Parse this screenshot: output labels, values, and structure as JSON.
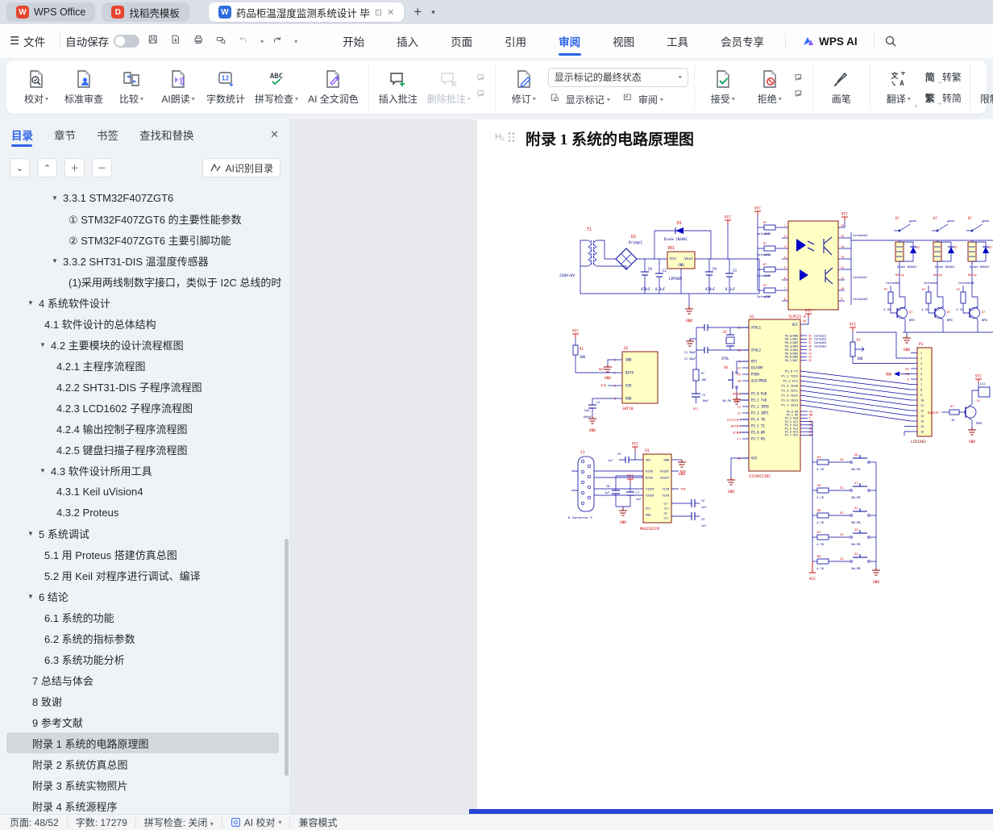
{
  "titlebar": {
    "tabs": [
      {
        "title": "WPS Office"
      },
      {
        "title": "找稻壳模板"
      },
      {
        "title": "药品柜温湿度监测系统设计 毕"
      }
    ],
    "new_tab": "+"
  },
  "menubar": {
    "file": "文件",
    "autosave": "自动保存",
    "items": [
      "开始",
      "插入",
      "页面",
      "引用",
      "审阅",
      "视图",
      "工具",
      "会员专享"
    ],
    "active": "审阅",
    "wps_ai": "WPS AI"
  },
  "ribbon": {
    "proofread": "校对",
    "standard_review": "标准审查",
    "compare": "比较",
    "ai_read": "AI朗读",
    "word_count": "字数统计",
    "spell_check": "拼写检查",
    "ai_polish": "AI 全文润色",
    "insert_comment": "插入批注",
    "delete_comment": "删除批注",
    "track_changes": "修订",
    "markup_state": "显示标记的最终状态",
    "show_markup": "显示标记",
    "reviewer": "审阅",
    "accept": "接受",
    "reject": "拒绝",
    "pen": "画笔",
    "translate": "翻译",
    "s2t_prefix": "简",
    "s2t": "转繁",
    "t2s_prefix": "繁",
    "t2s": "转简",
    "restrict": "限制编辑"
  },
  "sidebar": {
    "tabs": [
      "目录",
      "章节",
      "书签",
      "查找和替换"
    ],
    "active_tab": "目录",
    "ai_button": "AI识别目录",
    "toc": [
      {
        "l": 2,
        "a": 1,
        "t": "3.3.1 STM32F407ZGT6"
      },
      {
        "l": 3,
        "a": 0,
        "t": "① STM32F407ZGT6 的主要性能参数"
      },
      {
        "l": 3,
        "a": 0,
        "t": "② STM32F407ZGT6 主要引脚功能"
      },
      {
        "l": 2,
        "a": 1,
        "t": "3.3.2 SHT31-DIS 温湿度传感器"
      },
      {
        "l": 3,
        "a": 0,
        "t": "(1)采用两线制数字接口，类似于 I2C 总线的时 ..."
      },
      {
        "l": 0,
        "a": 1,
        "t": "4 系统软件设计"
      },
      {
        "l": 1,
        "a": 0,
        "t": "4.1 软件设计的总体结构"
      },
      {
        "l": 1,
        "a": 1,
        "t": "4.2 主要模块的设计流程框图"
      },
      {
        "l": 2,
        "a": 0,
        "t": "4.2.1 主程序流程图"
      },
      {
        "l": 2,
        "a": 0,
        "t": "4.2.2 SHT31-DIS 子程序流程图"
      },
      {
        "l": 2,
        "a": 0,
        "t": "4.2.3 LCD1602 子程序流程图"
      },
      {
        "l": 2,
        "a": 0,
        "t": "4.2.4 输出控制子程序流程图"
      },
      {
        "l": 2,
        "a": 0,
        "t": "4.2.5 键盘扫描子程序流程图"
      },
      {
        "l": 1,
        "a": 1,
        "t": "4.3 软件设计所用工具"
      },
      {
        "l": 2,
        "a": 0,
        "t": "4.3.1 Keil uVision4"
      },
      {
        "l": 2,
        "a": 0,
        "t": "4.3.2 Proteus"
      },
      {
        "l": 0,
        "a": 1,
        "t": "5 系统调试"
      },
      {
        "l": 1,
        "a": 0,
        "t": "5.1 用 Proteus 搭建仿真总图"
      },
      {
        "l": 1,
        "a": 0,
        "t": "5.2 用 Keil 对程序进行调试、编译"
      },
      {
        "l": 0,
        "a": 1,
        "t": "6 结论"
      },
      {
        "l": 1,
        "a": 0,
        "t": "6.1 系统的功能"
      },
      {
        "l": 1,
        "a": 0,
        "t": "6.2 系统的指标参数"
      },
      {
        "l": 1,
        "a": 0,
        "t": "6.3 系统功能分析"
      },
      {
        "l": 0,
        "a": 0,
        "t": "7 总结与体会"
      },
      {
        "l": 0,
        "a": 0,
        "t": "8 致谢"
      },
      {
        "l": 0,
        "a": 0,
        "t": "9 参考文献"
      },
      {
        "l": 0,
        "a": 0,
        "t": "附录 1 系统的电路原理图",
        "sel": 1
      },
      {
        "l": 0,
        "a": 0,
        "t": "附录 2 系统仿真总图"
      },
      {
        "l": 0,
        "a": 0,
        "t": "附录 3 系统实物照片"
      },
      {
        "l": 0,
        "a": 0,
        "t": "附录 4 系统源程序"
      }
    ]
  },
  "document": {
    "heading": "附录 1 系统的电路原理图",
    "h1_tag": "H₁"
  },
  "statusbar": {
    "page_label": "页面: 48/52",
    "words": "字数: 17279",
    "spell": "拼写检查: 关闭",
    "ai": "AI 校对",
    "mode": "兼容模式"
  },
  "schematic": {
    "power": {
      "t1": "T1",
      "ac": "220V~6V",
      "bridge_ref": "D2",
      "bridge_val": "Bridge1",
      "d1": "D1",
      "d1_val": "Diode 1N4001",
      "vr": "VR1",
      "vr_val": "LM7805",
      "vin": "Vin",
      "vout": "Vout",
      "gnd_pin": "GND",
      "vcc": "VCC",
      "caps": [
        [
          "C8",
          "470uF"
        ],
        [
          "C2",
          "0.3uF"
        ],
        [
          "C9",
          "470uF"
        ],
        [
          "C3",
          "0.1uF"
        ]
      ]
    },
    "opto": {
      "ref": "TLP521-4",
      "res_ref": "R?",
      "res_val": "470",
      "left_pins": [
        "Anode",
        "Cathod",
        "Anode",
        "Cathod",
        "Anode",
        "Cathod",
        "Anode",
        "Cathod"
      ],
      "right_pins": [
        "Collector",
        "Emitter",
        "Collector",
        "Emitter",
        "Collector",
        "Emitter",
        "Collector",
        "Emitter"
      ],
      "left_nets": [
        "Cathode2",
        "Cathode4",
        "Cathode6",
        "Cathode8"
      ],
      "right_nets": [
        "Cathode5",
        "Cathode7",
        "Cathode9"
      ]
    },
    "relays": {
      "coil": "Relay",
      "diode_ref": "D?",
      "diode_val": "Diode 1N4001",
      "k": "K?",
      "q": "Q?",
      "qt": "NPN",
      "r": "R?",
      "rv": "4.7K",
      "nets": [
        "Cathode6",
        "Cathode8",
        "Cathode10"
      ]
    },
    "mcu": {
      "ref": "U1",
      "part": "STC89C51RC",
      "vcc": "VCC",
      "left_pins": [
        [
          "19",
          "XTAL1"
        ],
        [
          "18",
          "XTAL2"
        ],
        [
          "9",
          "RST"
        ],
        [
          "31",
          "EA/VPP"
        ],
        [
          "29",
          "PSEN"
        ],
        [
          "30",
          "ALE/PROG"
        ],
        [
          "10",
          "P3.0 RxD"
        ],
        [
          "11",
          "P3.1 TxD"
        ],
        [
          "12",
          "P3.2 INT0"
        ],
        [
          "13",
          "P3.3 INT1"
        ],
        [
          "14",
          "P3.4 T0"
        ],
        [
          "15",
          "P3.5 T1"
        ],
        [
          "16",
          "P3.6 WR"
        ],
        [
          "17",
          "P3.7 RD"
        ],
        [
          "20",
          "VSS"
        ]
      ],
      "p0": [
        "P0.0/AD0",
        "P0.1/AD1",
        "P0.2/AD2",
        "P0.3/AD3",
        "P0.4/AD4",
        "P0.5/AD5",
        "P0.6/AD6",
        "P0.7/AD7"
      ],
      "p0_nums": [
        "39",
        "38",
        "37",
        "36",
        "35",
        "34",
        "33",
        "32"
      ],
      "p0_nets": [
        "Cathode1",
        "Cathode2",
        "Cathode3",
        "Cathode4"
      ],
      "p1": [
        "P1.0 T2",
        "P1.1 T2EX",
        "P1.2 ECI",
        "P1.3 CEX0",
        "P1.4 CEX1",
        "P1.5 CEX2",
        "P1.6 CEX3",
        "P1.7 CEX4"
      ],
      "p2": [
        "P2.0 A8",
        "P2.1 A9",
        "P2.2 A10",
        "P2.3 A11",
        "P2.4 A12",
        "P2.5 A13",
        "P2.6 A14",
        "P2.7 A15"
      ],
      "p2_nets": [
        "RS",
        "RW",
        "E",
        "S0",
        "S1",
        "S2",
        "S3",
        "S4"
      ],
      "xtal_ref": "X1",
      "xtal_val": "XTAL",
      "c1": "C1 30pF",
      "c2": "C2 30pF",
      "r10k": [
        "R?",
        "10K"
      ],
      "c3": [
        "C3",
        "10uF"
      ],
      "rst_sw": "S8",
      "rst_sw_val": "SW-PB",
      "rxd": "RXD",
      "txd": "TXD",
      "buz": "buzzer",
      "data": "DATA",
      "sck": "SCK"
    },
    "sensor": {
      "ref": "U2",
      "part": "SHT10",
      "pins": [
        [
          "1",
          "GND"
        ],
        [
          "2",
          "DATA"
        ],
        [
          "3",
          "SCK"
        ],
        [
          "4",
          "VDD"
        ]
      ],
      "r1": "R1",
      "r1v": "10K",
      "c4": [
        "C4",
        "Cap",
        "100nF"
      ],
      "data": "DATA",
      "sck": "SCK"
    },
    "serial": {
      "j1": "J1",
      "j1_val": "D Connector 9",
      "u3": "U3",
      "part": "MAX232CPE",
      "rxd": "RXD",
      "txd": "TXD",
      "left_pins": [
        "VEE",
        "R1IN",
        "R2IN",
        "T1OUT",
        "T2OUT",
        "VCC",
        "VDD"
      ],
      "right_pins": [
        "GND",
        "R1OUT",
        "R2OUT",
        "T1IN",
        "T2IN",
        "C2-",
        "C2+",
        "C1-",
        "C1+"
      ],
      "caps": [
        [
          "C9",
          "1uF"
        ],
        [
          "C8",
          "1uF"
        ],
        [
          "C7",
          "1uF"
        ],
        [
          "C6",
          "1uF"
        ],
        [
          "C5",
          "1uF"
        ]
      ]
    },
    "lcd": {
      "ref": "P1",
      "part": "LCD1602",
      "nets": [
        "RS",
        "RW",
        "E"
      ],
      "pot": [
        "R?",
        "10K"
      ]
    },
    "buzzer": {
      "net": "buzzer",
      "r": "R?",
      "rv": "1K",
      "q": "Q?",
      "qt": "PNP",
      "ls": "LS1"
    },
    "keypad": {
      "rows": [
        [
          "R4",
          "4.7K",
          "S0",
          "SW-PB"
        ],
        [
          "R5",
          "4.7K",
          "S1",
          "SW-PB"
        ],
        [
          "R6",
          "4.7K",
          "S2",
          "SW-PB"
        ],
        [
          "R7",
          "4.7K",
          "S3",
          "SW-PB"
        ],
        [
          "R8",
          "4.7K",
          "S4",
          "SW-PB"
        ]
      ]
    },
    "net": {
      "vcc": "VCC",
      "gnd": "GND"
    }
  }
}
